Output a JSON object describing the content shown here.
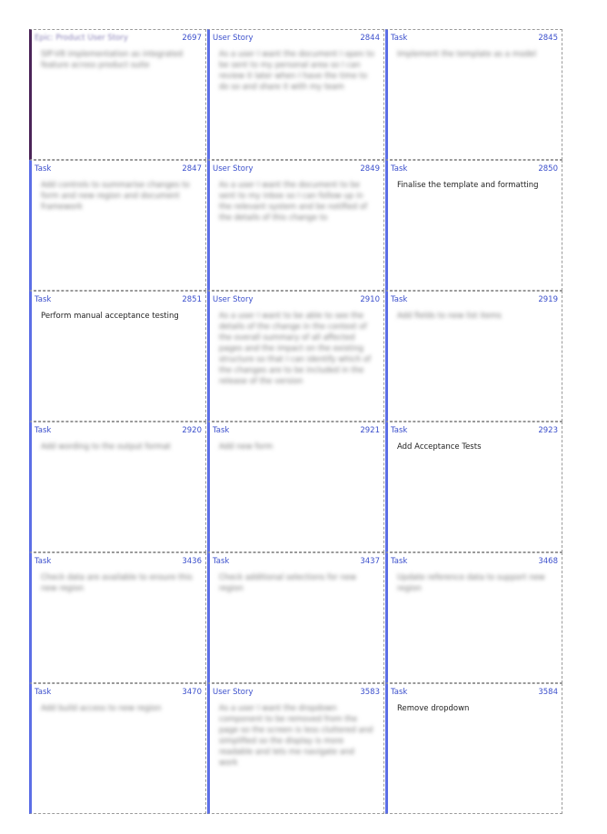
{
  "cards": [
    {
      "type": "Epic: Product User Story",
      "id": "2697",
      "text": "SIP-V8 implementation as integrated feature across product suite",
      "redacted": true,
      "accent": "purple"
    },
    {
      "type": "User Story",
      "id": "2844",
      "text": "As a user I want the document I open to be sent to my personal area so I can review it later when I have the time to do so and share it with my team",
      "redacted": true,
      "accent": "blue"
    },
    {
      "type": "Task",
      "id": "2845",
      "text": "Implement the template as a model",
      "redacted": true,
      "accent": "blue"
    },
    {
      "type": "Task",
      "id": "2847",
      "text": "Add controls to summarise changes to form and new region and document framework",
      "redacted": true,
      "accent": "blue"
    },
    {
      "type": "User Story",
      "id": "2849",
      "text": "As a user I want the document to be sent to my inbox so I can follow up in the relevant system and be notified of the details of this change to",
      "redacted": true,
      "accent": "blue"
    },
    {
      "type": "Task",
      "id": "2850",
      "text": "Finalise the template and formatting",
      "redacted": false,
      "accent": "blue"
    },
    {
      "type": "Task",
      "id": "2851",
      "text": "Perform manual acceptance testing",
      "redacted": false,
      "accent": "blue"
    },
    {
      "type": "User Story",
      "id": "2910",
      "text": "As a user I want to be able to see the details of the change in the context of the overall summary of all affected pages and the impact on the existing structure so that I can identify which of the changes are to be included in the release of the version",
      "redacted": true,
      "accent": "blue"
    },
    {
      "type": "Task",
      "id": "2919",
      "text": "Add fields to new list items",
      "redacted": true,
      "accent": "blue"
    },
    {
      "type": "Task",
      "id": "2920",
      "text": "Add wording to the output format",
      "redacted": true,
      "accent": "blue"
    },
    {
      "type": "Task",
      "id": "2921",
      "text": "Add new form",
      "redacted": true,
      "accent": "blue"
    },
    {
      "type": "Task",
      "id": "2923",
      "text": "Add Acceptance Tests",
      "redacted": false,
      "accent": "blue"
    },
    {
      "type": "Task",
      "id": "3436",
      "text": "Check data are available to ensure this new region",
      "redacted": true,
      "accent": "blue"
    },
    {
      "type": "Task",
      "id": "3437",
      "text": "Check additional selections for new region",
      "redacted": true,
      "accent": "blue"
    },
    {
      "type": "Task",
      "id": "3468",
      "text": "Update reference data to support new region",
      "redacted": true,
      "accent": "blue"
    },
    {
      "type": "Task",
      "id": "3470",
      "text": "Add build access to new region",
      "redacted": true,
      "accent": "blue"
    },
    {
      "type": "User Story",
      "id": "3583",
      "text": "As a user I want the dropdown component to be removed from the page so the screen is less cluttered and simplified so the display is more readable and lets me navigate and work",
      "redacted": true,
      "accent": "blue"
    },
    {
      "type": "Task",
      "id": "3584",
      "text": "Remove dropdown",
      "redacted": false,
      "accent": "blue"
    }
  ]
}
